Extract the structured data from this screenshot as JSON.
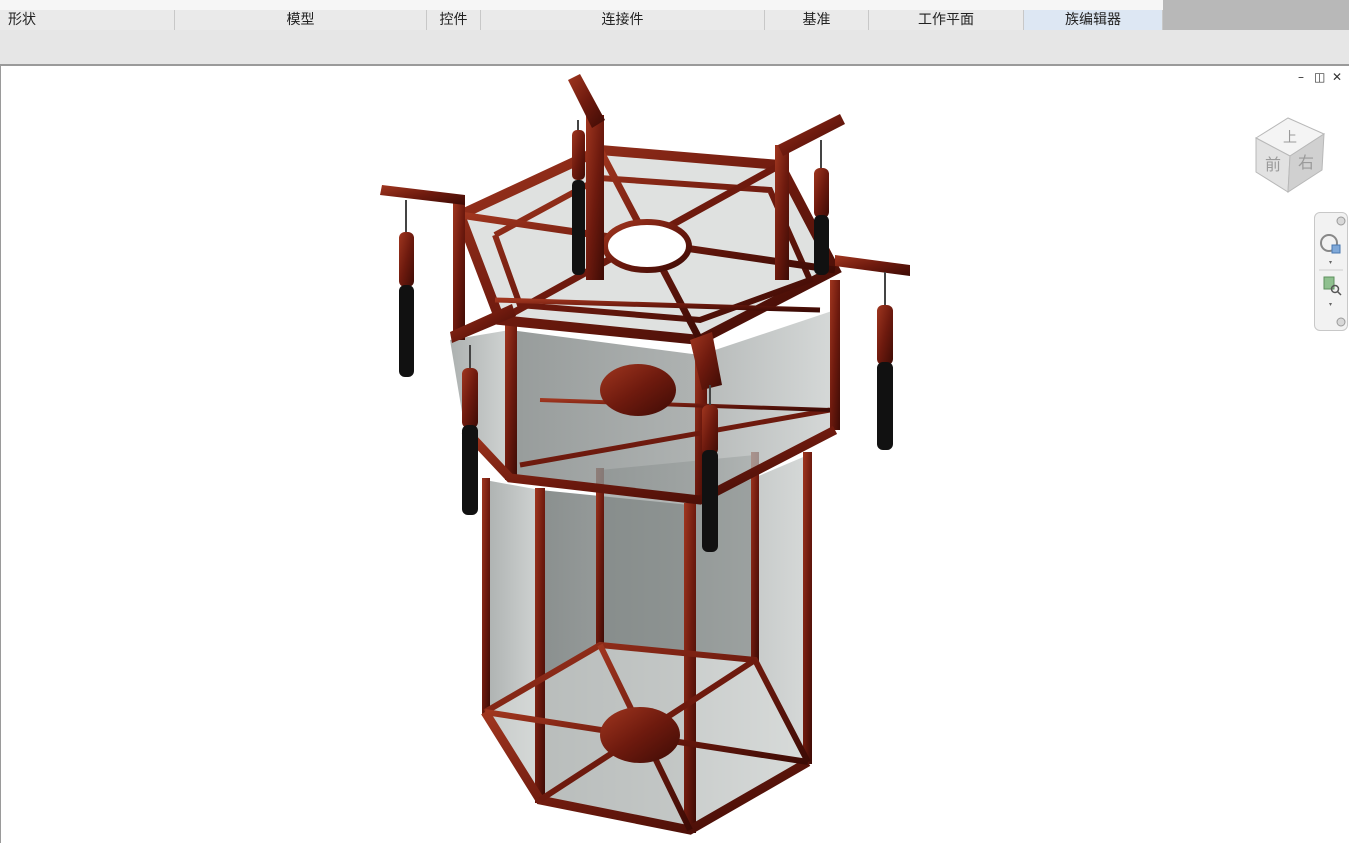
{
  "ribbon": {
    "panels": [
      {
        "label": "形状",
        "active": false
      },
      {
        "label": "模型",
        "active": false
      },
      {
        "label": "控件",
        "active": false
      },
      {
        "label": "连接件",
        "active": false
      },
      {
        "label": "基准",
        "active": false
      },
      {
        "label": "工作平面",
        "active": false
      },
      {
        "label": "族编辑器",
        "active": true
      }
    ]
  },
  "window_controls": {
    "minimize": "–",
    "restore": "◫",
    "close": "✕"
  },
  "view_cube": {
    "top": "上",
    "front": "前",
    "right": "右"
  },
  "colors": {
    "wood": "#6e1a0e",
    "glass": "#b4b9b8",
    "tassel": "#111111"
  }
}
